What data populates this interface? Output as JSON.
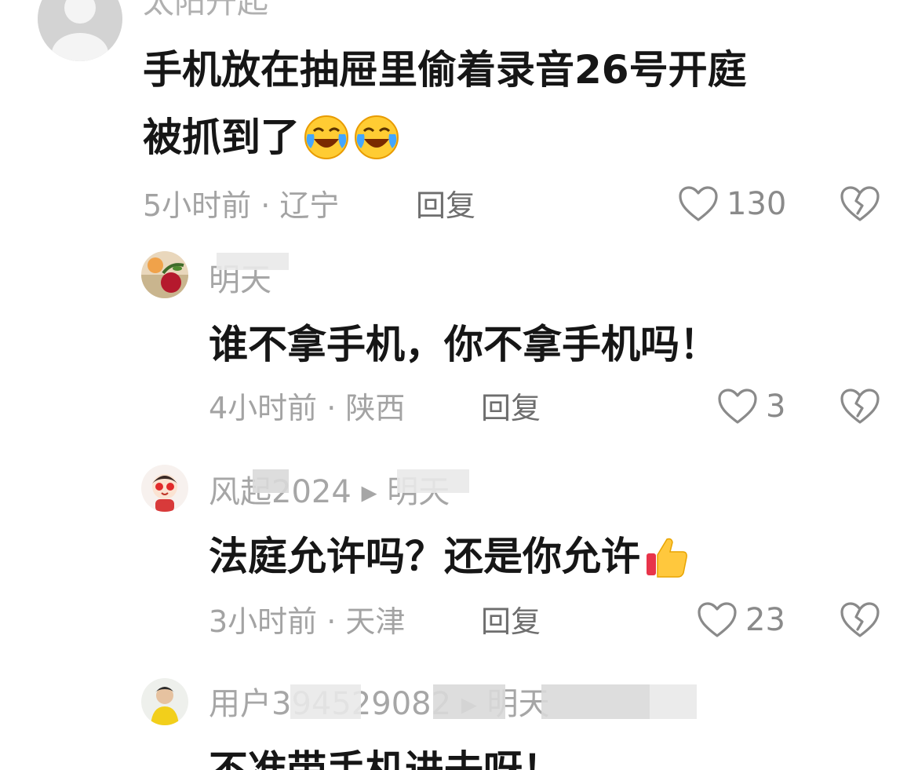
{
  "comments": [
    {
      "username": "太阳升起",
      "text_lines": [
        "手机放在抽屉里偷着录音26号开庭",
        "被抓到了"
      ],
      "emojis": [
        "crying-laughing-emoji",
        "crying-laughing-emoji"
      ],
      "time": "5小时前 · 辽宁",
      "reply_label": "回复",
      "likes": "130"
    },
    {
      "username": "明天",
      "text": "谁不拿手机，你不拿手机吗！",
      "time": "4小时前 · 陕西",
      "reply_label": "回复",
      "likes": "3"
    },
    {
      "username": "风起2024 ▸ 明天",
      "text": "法庭允许吗？还是你允许",
      "emoji": "thumbs-up-emoji",
      "time": "3小时前 · 天津",
      "reply_label": "回复",
      "likes": "23"
    },
    {
      "username": "用户394529082 ▸ 明天",
      "text": "不准带手机进去呀！"
    }
  ],
  "icons": {
    "like": "heart-outline-icon",
    "dislike": "broken-heart-icon"
  },
  "colors": {
    "text": "#161616",
    "muted": "#a3a3a3",
    "reply": "#6e6e6e",
    "icon": "#8a8a8a"
  }
}
